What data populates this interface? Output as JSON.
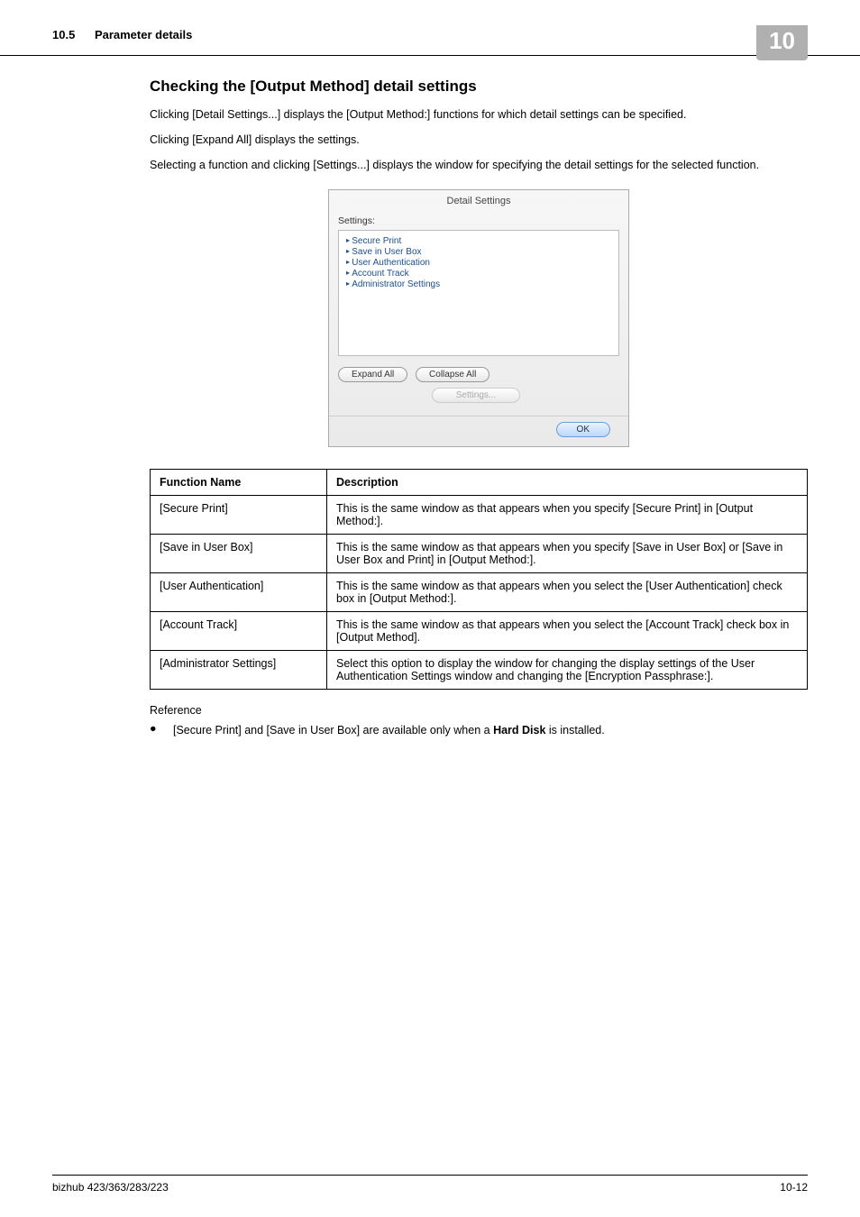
{
  "header": {
    "section": "10.5",
    "title": "Parameter details",
    "chapter": "10"
  },
  "heading": "Checking the [Output Method] detail settings",
  "paragraphs": {
    "p1": "Clicking [Detail Settings...] displays the [Output Method:] functions for which detail settings can be specified.",
    "p2": "Clicking [Expand All] displays the settings.",
    "p3": "Selecting a function and clicking [Settings...] displays the window for specifying the detail settings for the selected function."
  },
  "dialog": {
    "title": "Detail Settings",
    "settings_label": "Settings:",
    "items": [
      "Secure Print",
      "Save in User Box",
      "User Authentication",
      "Account Track",
      "Administrator Settings"
    ],
    "expand": "Expand All",
    "collapse": "Collapse All",
    "settings_btn": "Settings...",
    "ok": "OK"
  },
  "table": {
    "headers": {
      "name": "Function Name",
      "desc": "Description"
    },
    "rows": [
      {
        "name": "[Secure Print]",
        "desc": "This is the same window as that appears when you specify [Secure Print] in [Output Method:]."
      },
      {
        "name": "[Save in User Box]",
        "desc": "This is the same window as that appears when you specify [Save in User Box] or [Save in User Box and Print] in [Output Method:]."
      },
      {
        "name": "[User Authentication]",
        "desc": "This is the same window as that appears when you select the [User Authentication] check box in [Output Method:]."
      },
      {
        "name": "[Account Track]",
        "desc": "This is the same window as that appears when you select the [Account Track] check box in [Output Method]."
      },
      {
        "name": "[Administrator Settings]",
        "desc": "Select this option to display the window for changing the display settings of the User Authentication Settings window and changing the [Encryption Passphrase:]."
      }
    ]
  },
  "reference": {
    "label": "Reference",
    "bullet_pre": "[Secure Print] and [Save in User Box] are available only when a ",
    "bullet_bold": "Hard Disk",
    "bullet_post": " is installed."
  },
  "footer": {
    "left": "bizhub 423/363/283/223",
    "right": "10-12"
  }
}
